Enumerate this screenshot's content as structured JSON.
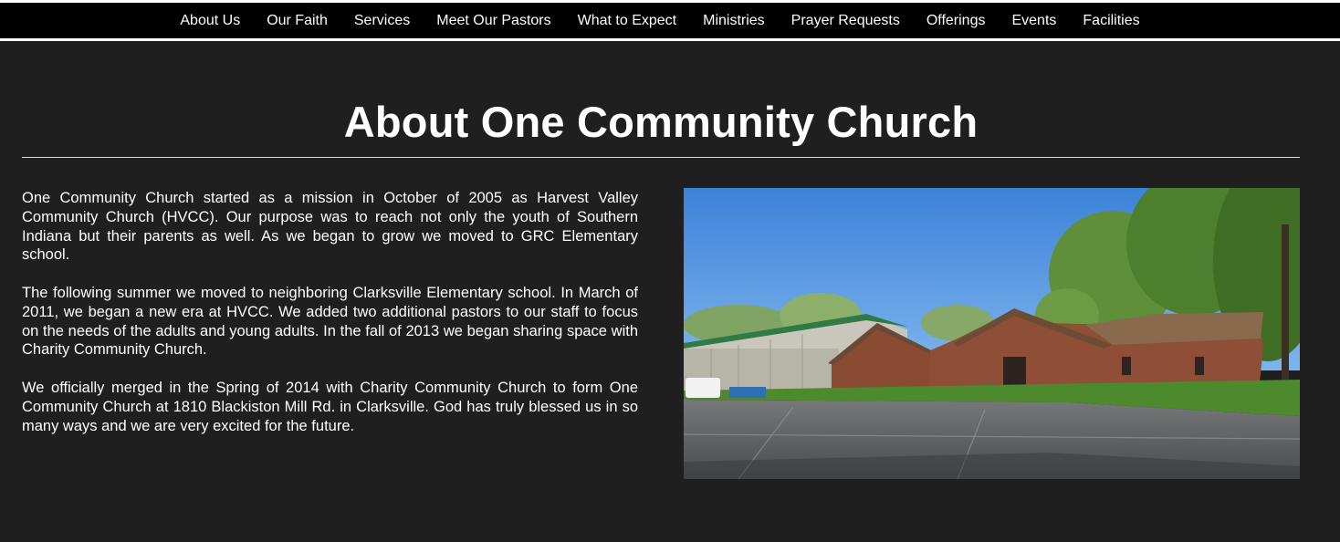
{
  "nav": {
    "items": [
      "About Us",
      "Our Faith",
      "Services",
      "Meet Our Pastors",
      "What to Expect",
      "Ministries",
      "Prayer Requests",
      "Offerings",
      "Events",
      "Facilities"
    ]
  },
  "main": {
    "title": "About One Community Church",
    "paragraphs": [
      "One Community Church started as a mission in October of 2005 as Harvest Valley Community Church (HVCC). Our purpose was to reach not only the youth of Southern Indiana but their parents as well. As we began to grow we moved to GRC Elementary school.",
      "The following summer we moved to neighboring Clarksville Elementary school. In March of 2011, we began a new era at HVCC. We added two additional pastors to our staff to focus on the needs of the adults and young adults. In the fall of 2013 we began sharing space with Charity Community Church.",
      "We officially merged in the Spring of 2014 with Charity Community Church to form One Community Church at 1810 Blackiston Mill Rd. in Clarksville. God has truly blessed us in so many ways and we are very excited for the future."
    ]
  },
  "colors": {
    "background": "#1f1f1f",
    "nav_background": "#000000",
    "text": "#ffffff"
  }
}
